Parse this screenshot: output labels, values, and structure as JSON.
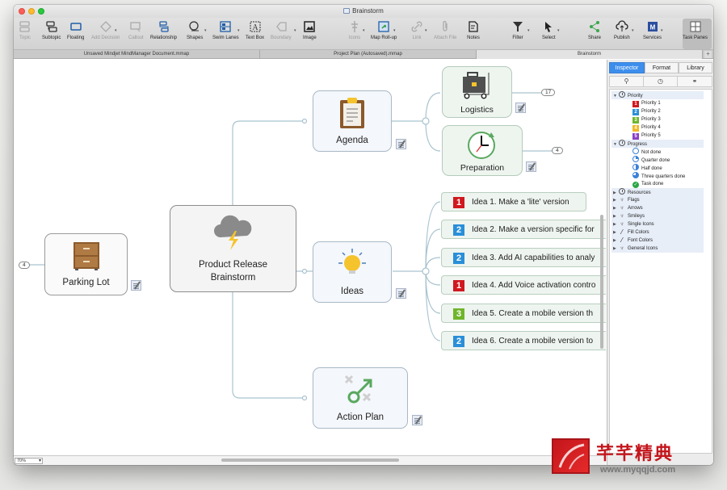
{
  "window": {
    "title": "Brainstorm"
  },
  "toolbar": {
    "buttons": [
      {
        "id": "topic",
        "label": "Topic",
        "icon": "topic-icon",
        "enabled": false
      },
      {
        "id": "subtopic",
        "label": "Subtopic",
        "icon": "subtopic-icon",
        "enabled": true
      },
      {
        "id": "floating",
        "label": "Floating",
        "icon": "floating-topic-icon",
        "enabled": true
      },
      {
        "id": "add-decision",
        "label": "Add Decision",
        "icon": "decision-icon",
        "enabled": false
      },
      {
        "id": "callout",
        "label": "Callout",
        "icon": "callout-icon",
        "enabled": false
      },
      {
        "id": "relationship",
        "label": "Relationship",
        "icon": "relationship-icon",
        "enabled": true
      },
      {
        "id": "shapes",
        "label": "Shapes",
        "icon": "shapes-icon",
        "enabled": true
      },
      {
        "id": "swim-lanes",
        "label": "Swim Lanes",
        "icon": "swim-lanes-icon",
        "enabled": true
      },
      {
        "id": "text-box",
        "label": "Text Box",
        "icon": "text-box-icon",
        "enabled": true
      },
      {
        "id": "boundary",
        "label": "Boundary",
        "icon": "boundary-icon",
        "enabled": false
      },
      {
        "id": "image",
        "label": "Image",
        "icon": "image-icon",
        "enabled": true
      },
      {
        "id": "icons",
        "label": "Icons",
        "icon": "icons-icon",
        "enabled": false
      },
      {
        "id": "map-rollup",
        "label": "Map Roll-up",
        "icon": "map-rollup-icon",
        "enabled": true
      },
      {
        "id": "link",
        "label": "Link",
        "icon": "link-icon",
        "enabled": false
      },
      {
        "id": "attach-file",
        "label": "Attach File",
        "icon": "paperclip-icon",
        "enabled": false
      },
      {
        "id": "notes",
        "label": "Notes",
        "icon": "notes-icon",
        "enabled": true
      },
      {
        "id": "filter",
        "label": "Filter",
        "icon": "filter-icon",
        "enabled": true
      },
      {
        "id": "select",
        "label": "Select",
        "icon": "cursor-icon",
        "enabled": true
      },
      {
        "id": "share",
        "label": "Share",
        "icon": "share-icon",
        "enabled": true
      },
      {
        "id": "publish",
        "label": "Publish",
        "icon": "cloud-upload-icon",
        "enabled": true
      },
      {
        "id": "services",
        "label": "Services",
        "icon": "services-icon",
        "enabled": true
      },
      {
        "id": "task-panes",
        "label": "Task Panes",
        "icon": "task-panes-icon",
        "enabled": true
      }
    ]
  },
  "doc_tabs": [
    {
      "label": "Unsaved Mindjet MindManager Document.mmap",
      "active": false
    },
    {
      "label": "Project Plan (Autosaved).mmap",
      "active": false
    },
    {
      "label": "Brainstorm",
      "active": true
    }
  ],
  "tab_add_label": "+",
  "map": {
    "central": {
      "label_line1": "Product Release",
      "label_line2": "Brainstorm",
      "icon": "storm-cloud-icon"
    },
    "parking_lot": {
      "label": "Parking Lot",
      "icon": "cabinet-icon",
      "collapsed_count": "4"
    },
    "agenda": {
      "label": "Agenda",
      "icon": "clipboard-icon"
    },
    "logistics": {
      "label": "Logistics",
      "icon": "luggage-cart-icon",
      "collapsed_count": "17"
    },
    "preparation": {
      "label": "Preparation",
      "icon": "clock-icon",
      "collapsed_count": "4"
    },
    "ideas": {
      "label": "Ideas",
      "icon": "lightbulb-icon"
    },
    "action_plan": {
      "label": "Action Plan",
      "icon": "strategy-icon"
    },
    "idea_items": [
      {
        "priority": "1",
        "color": "#d0181e",
        "text": "Idea 1. Make a 'lite' version"
      },
      {
        "priority": "2",
        "color": "#2a8fd8",
        "text": "Idea 2. Make a version specific for"
      },
      {
        "priority": "2",
        "color": "#2a8fd8",
        "text": "Idea 3. Add AI capabilities to analy"
      },
      {
        "priority": "1",
        "color": "#d0181e",
        "text": "Idea 4. Add Voice activation contro"
      },
      {
        "priority": "3",
        "color": "#6fb52c",
        "text": "Idea 5. Create a mobile version th"
      },
      {
        "priority": "2",
        "color": "#2a8fd8",
        "text": "Idea 6. Create a mobile version to"
      }
    ]
  },
  "statusbar": {
    "zoom": "70%"
  },
  "panel": {
    "tabs": [
      {
        "label": "Inspector",
        "active": true
      },
      {
        "label": "Format",
        "active": false
      },
      {
        "label": "Library",
        "active": false
      }
    ],
    "sub_buttons": [
      "icons-filter-icon",
      "clock-icon",
      "link-icon"
    ],
    "tree": {
      "priority": {
        "label": "Priority",
        "items": [
          {
            "label": "Priority 1",
            "num": "1",
            "color": "#d0181e"
          },
          {
            "label": "Priority 2",
            "num": "2",
            "color": "#2a8fd8"
          },
          {
            "label": "Priority 3",
            "num": "3",
            "color": "#6fb52c"
          },
          {
            "label": "Priority 4",
            "num": "4",
            "color": "#f2b823"
          },
          {
            "label": "Priority 5",
            "num": "5",
            "color": "#8a3fc6"
          }
        ]
      },
      "progress": {
        "label": "Progress",
        "items": [
          {
            "label": "Not done",
            "fill": 0
          },
          {
            "label": "Quarter done",
            "fill": 0.25
          },
          {
            "label": "Half done",
            "fill": 0.5
          },
          {
            "label": "Three quarters done",
            "fill": 0.75
          },
          {
            "label": "Task done",
            "fill": 1
          }
        ]
      },
      "groups": [
        {
          "label": "Resources",
          "icon": "clock-icon"
        },
        {
          "label": "Flags",
          "icon": "pin-icon"
        },
        {
          "label": "Arrows",
          "icon": "pin-icon"
        },
        {
          "label": "Smileys",
          "icon": "pin-icon"
        },
        {
          "label": "Single Icons",
          "icon": "pin-icon"
        },
        {
          "label": "Fill Colors",
          "icon": "brush-icon"
        },
        {
          "label": "Font Colors",
          "icon": "brush-icon"
        },
        {
          "label": "General Icons",
          "icon": "pin-icon"
        }
      ]
    }
  },
  "watermark": {
    "text": "芊芊精典",
    "url": "www.myqqjd.com"
  }
}
